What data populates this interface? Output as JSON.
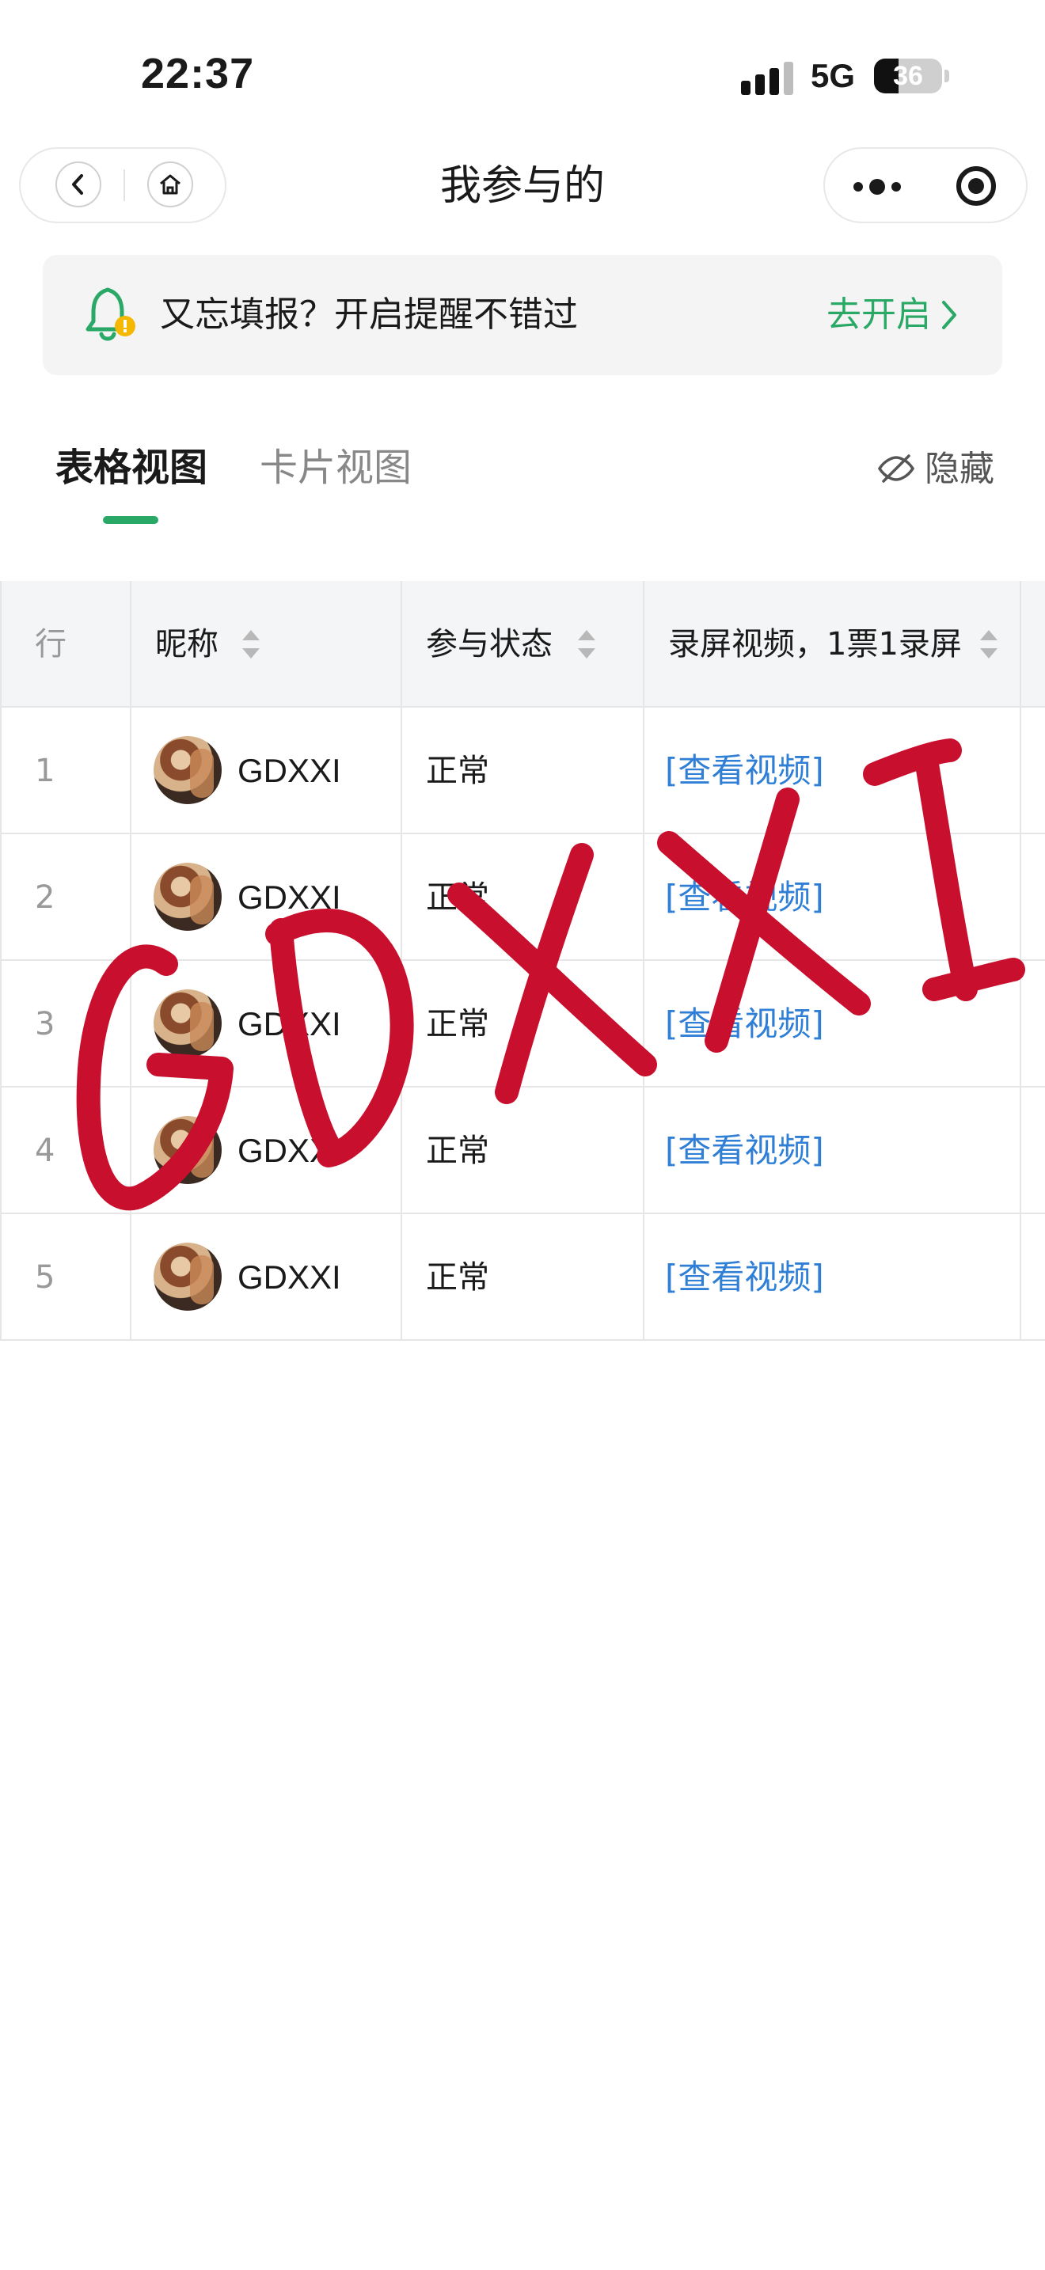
{
  "status_bar": {
    "time": "22:37",
    "network": "5G",
    "battery_level": "36",
    "battery_fraction": 0.36
  },
  "nav": {
    "title": "我参与的",
    "back_icon": "chevron-left-icon",
    "home_icon": "home-icon",
    "more_icon": "more-dots-icon",
    "close_icon": "target-icon"
  },
  "banner": {
    "text": "又忘填报？开启提醒不错过",
    "action": "去开启",
    "accent_color": "#2aa865",
    "badge_color": "#f5b800"
  },
  "tabs": {
    "active": "表格视图",
    "inactive": "卡片视图",
    "hide_label": "隐藏"
  },
  "table": {
    "headers": {
      "row": "行",
      "nickname": "昵称",
      "status": "参与状态",
      "video": "录屏视频，1票1录屏"
    },
    "rows": [
      {
        "num": "1",
        "nickname": "GDXXI",
        "status": "正常",
        "video": "[查看视频]"
      },
      {
        "num": "2",
        "nickname": "GDXXI",
        "status": "正常",
        "video": "[查看视频]"
      },
      {
        "num": "3",
        "nickname": "GDXXI",
        "status": "正常",
        "video": "[查看视频]"
      },
      {
        "num": "4",
        "nickname": "GDXXI",
        "status": "正常",
        "video": "[查看视频]"
      },
      {
        "num": "5",
        "nickname": "GDXXI",
        "status": "正常",
        "video": "[查看视频]"
      }
    ],
    "link_color": "#2f7fd6"
  },
  "watermark": {
    "text": "GDXXI",
    "color": "#c8102e"
  }
}
